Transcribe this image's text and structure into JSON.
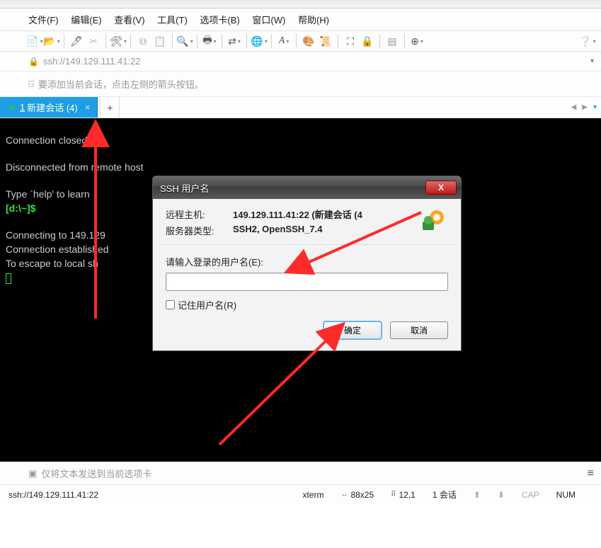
{
  "menubar": [
    "文件(F)",
    "编辑(E)",
    "查看(V)",
    "工具(T)",
    "选项卡(B)",
    "窗口(W)",
    "帮助(H)"
  ],
  "address": {
    "url": "ssh://149.129.111.41:22"
  },
  "hint": {
    "text": "要添加当前会话，点击左侧的箭头按钮。"
  },
  "tab": {
    "index": "1",
    "label": "新建会话 (4)"
  },
  "terminal": {
    "l1": "Connection closed.",
    "l2": "Disconnected from remote host",
    "l3a": "Type `help' to learn",
    "l3b": "[d:\\~]$",
    "l4": "Connecting to 149.129",
    "l5": "Connection established",
    "l6": "To escape to local sh"
  },
  "dialog": {
    "title": "SSH 用户名",
    "host_lbl": "远程主机:",
    "host_val": "149.129.111.41:22 (新建会话 (4",
    "server_lbl": "服务器类型:",
    "server_val": "SSH2, OpenSSH_7.4",
    "user_lbl": "请输入登录的用户名(E):",
    "remember": "记住用户名(R)",
    "ok": "确定",
    "cancel": "取消"
  },
  "bottom": {
    "text": "仅将文本发送到当前选项卡"
  },
  "status": {
    "conn": "ssh://149.129.111.41:22",
    "term": "xterm",
    "size": "88x25",
    "pos": "12,1",
    "sess": "1 会话",
    "cap": "CAP",
    "num": "NUM"
  }
}
